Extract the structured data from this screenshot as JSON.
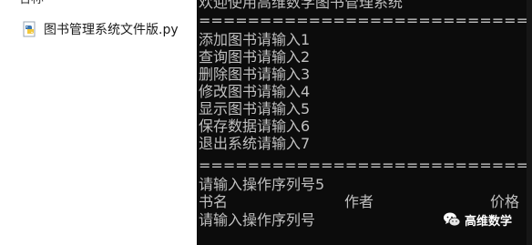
{
  "explorer": {
    "header_clipped": "名称",
    "file": {
      "name": "图书管理系统文件版.py",
      "icon": "python-file-icon"
    }
  },
  "console": {
    "welcome": "欢迎使用高维数学图书管理系统",
    "separator": "==============================================================",
    "menu": [
      "添加图书请输入1",
      "查询图书请输入2",
      "删除图书请输入3",
      "修改图书请输入4",
      "显示图书请输入5",
      "保存数据请输入6",
      "退出系统请输入7"
    ],
    "separator2": "==============================================================",
    "prompt_entered": "请输入操作序列号5",
    "table_headers": {
      "name": "书名",
      "author": "作者",
      "price": "价格"
    },
    "prompt_current": "请输入操作序列号",
    "colors": {
      "background": "#0c0c0c",
      "text": "#c0c0c0"
    }
  },
  "watermark": {
    "text": "高维数学",
    "icon": "wechat-logo-icon"
  }
}
